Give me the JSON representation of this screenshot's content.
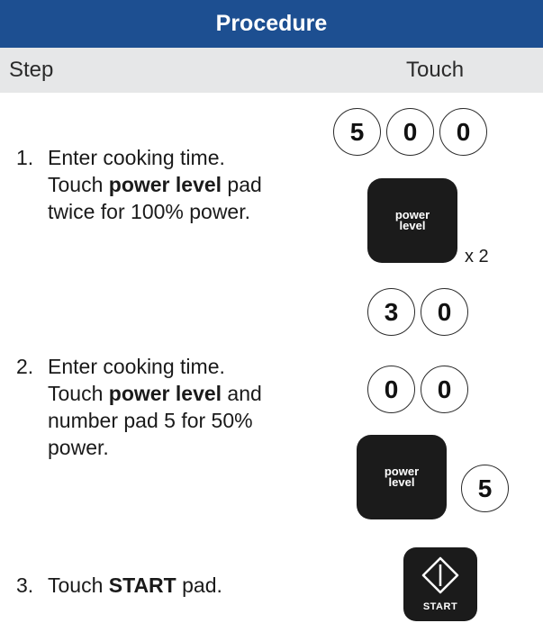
{
  "header": {
    "title": "Procedure"
  },
  "columns": {
    "step": "Step",
    "touch": "Touch"
  },
  "steps": [
    {
      "number": "1.",
      "lines": [
        "Enter cooking time."
      ],
      "line2_pre": "Touch ",
      "line2_bold": "power level",
      "line2_post": " pad",
      "line3": "twice for 100% power.",
      "touch": {
        "digits": [
          "5",
          "0",
          "0"
        ],
        "pad_label": "power\nlevel",
        "repeat": "x 2"
      }
    },
    {
      "number": "2.",
      "line1": "Enter cooking time.",
      "line2_pre": "Touch ",
      "line2_bold": "power level",
      "line2_post": " and",
      "line3": "number pad 5 for 50%",
      "line4": "power.",
      "touch": {
        "digits_row1": [
          "3",
          "0"
        ],
        "digits_row2": [
          "0",
          "0"
        ],
        "pad_label": "power\nlevel",
        "digit_after_pad": "5"
      }
    },
    {
      "number": "3.",
      "line1_pre": "Touch ",
      "line1_bold": "START",
      "line1_post": " pad.",
      "touch": {
        "start_label": "START",
        "icon": "start-diamond-icon"
      }
    }
  ],
  "colors": {
    "header_bg": "#1d4f91",
    "subheader_bg": "#e6e7e8",
    "pad_bg": "#1b1b1b"
  }
}
